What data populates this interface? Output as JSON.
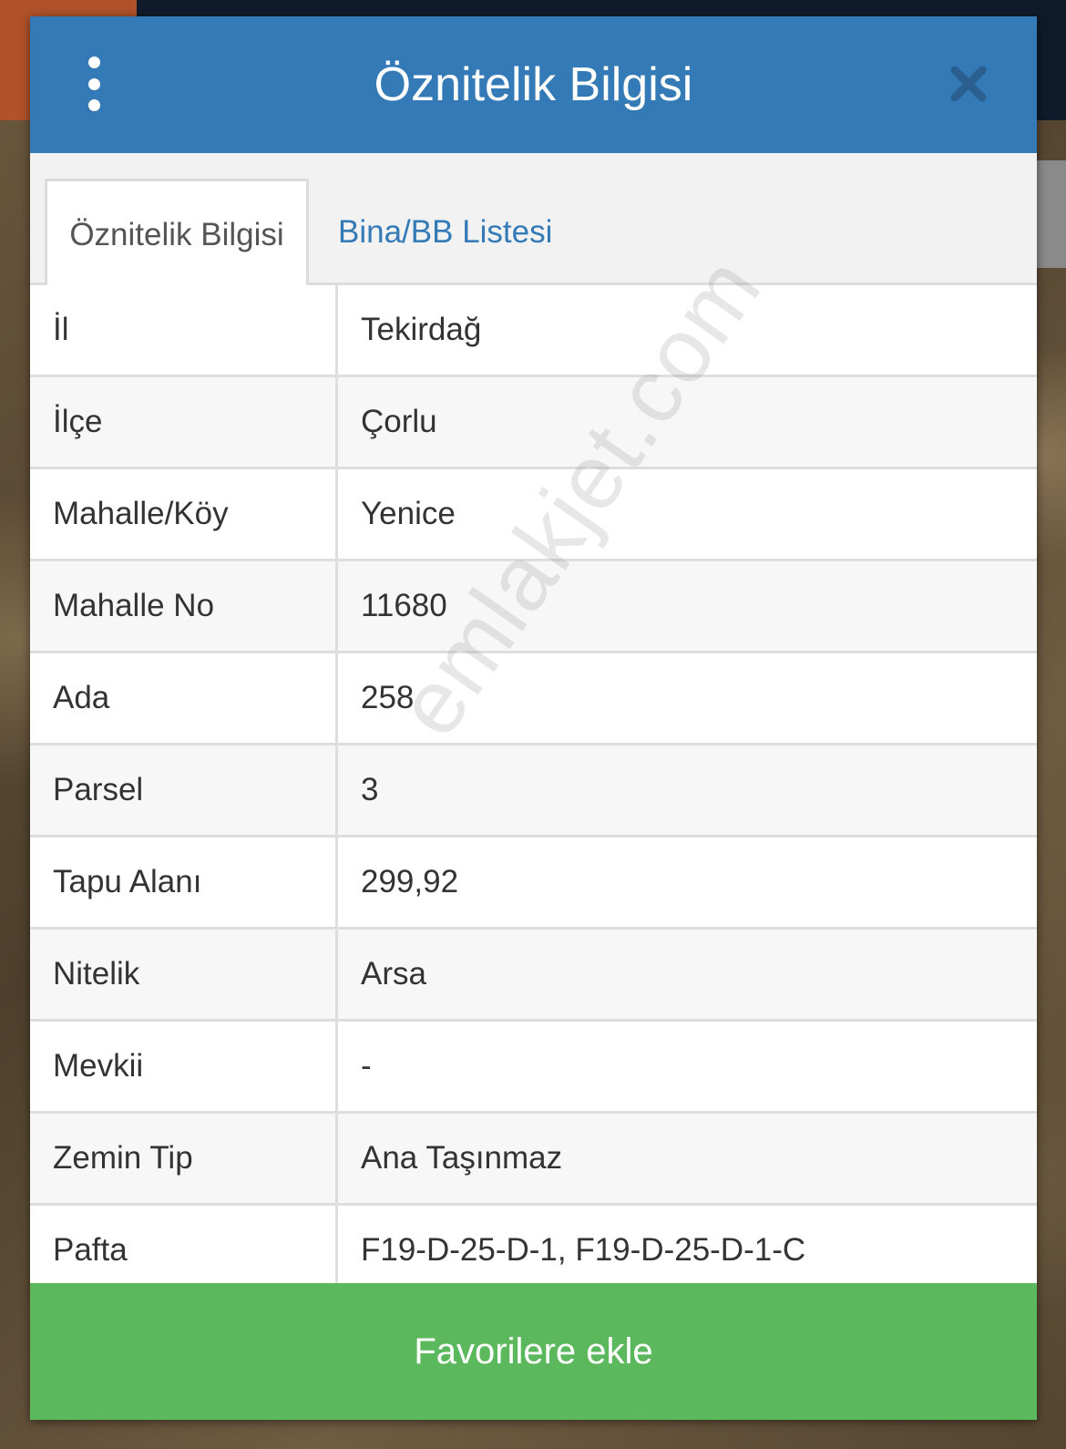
{
  "dialog": {
    "title": "Öznitelik Bilgisi",
    "accent_color": "#337ab7",
    "menu_icon": "more-vertical-icon",
    "close_icon": "close-icon"
  },
  "tabs": [
    {
      "label": "Öznitelik Bilgisi",
      "active": true
    },
    {
      "label": "Bina/BB Listesi",
      "active": false
    }
  ],
  "rows": [
    {
      "label": "İl",
      "value": "Tekirdağ"
    },
    {
      "label": "İlçe",
      "value": "Çorlu"
    },
    {
      "label": "Mahalle/Köy",
      "value": "Yenice"
    },
    {
      "label": "Mahalle No",
      "value": "11680"
    },
    {
      "label": "Ada",
      "value": "258"
    },
    {
      "label": "Parsel",
      "value": "3"
    },
    {
      "label": "Tapu Alanı",
      "value": "299,92"
    },
    {
      "label": "Nitelik",
      "value": "Arsa"
    },
    {
      "label": "Mevkii",
      "value": "-"
    },
    {
      "label": "Zemin Tip",
      "value": "Ana Taşınmaz"
    },
    {
      "label": "Pafta",
      "value": "F19-D-25-D-1, F19-D-25-D-1-C"
    }
  ],
  "watermark": "emlakjet.com",
  "favorite_button": {
    "label": "Favorilere ekle",
    "color": "#5cb85c"
  }
}
